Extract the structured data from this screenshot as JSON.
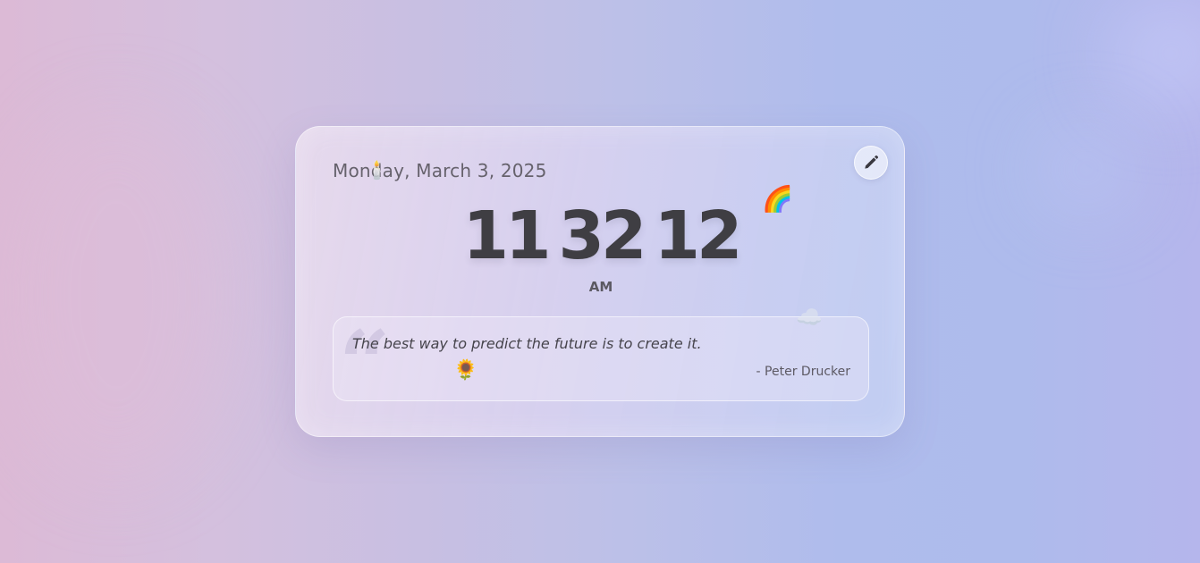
{
  "widget": {
    "date": "Monday, March 3, 2025",
    "time": {
      "hours": "11",
      "minutes": "32",
      "seconds": "12"
    },
    "meridiem": "AM",
    "quote": {
      "text": "The best way to predict the future is to create it.",
      "author": "- Peter Drucker",
      "mark": "“"
    }
  },
  "decorations": {
    "rainbow": "🌈",
    "cloud": "☁️",
    "sunflower": "🌻",
    "candle": "🕯️"
  },
  "icons": {
    "edit": "pencil-icon"
  },
  "colors": {
    "text_primary": "#3f3e43",
    "text_secondary": "#66626c",
    "accent_gradient_start": "#dcbad6",
    "accent_gradient_end": "#aebbec"
  }
}
